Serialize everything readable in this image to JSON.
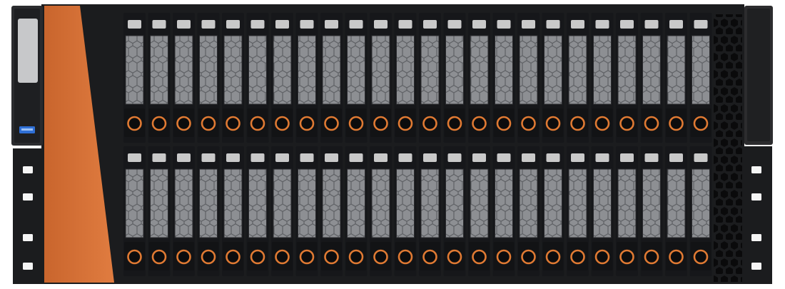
{
  "device": {
    "kind": "rack-mount storage server front panel",
    "rows_of_bays": 2,
    "bays_per_row": 24,
    "total_bays": 48
  },
  "colors": {
    "chassis": "#1b1c1e",
    "chassis_edge": "#2a2b2e",
    "bezel_accent": "#d8743a",
    "bay_frame": "#16171a",
    "mesh_fill": "#8d8f93",
    "mesh_line": "#5a5c60",
    "label_slot": "#c9c9c9",
    "handle_ring": "#e07a33",
    "usb_port": "#2f6fd6",
    "rack_hole": "#f5f5f5",
    "side_panel": "#2c2c2e"
  },
  "icons": {
    "usb_port": "usb-port-icon",
    "handle_ring": "drive-release-ring-icon",
    "rack_hole": "rack-mount-hole-icon"
  }
}
